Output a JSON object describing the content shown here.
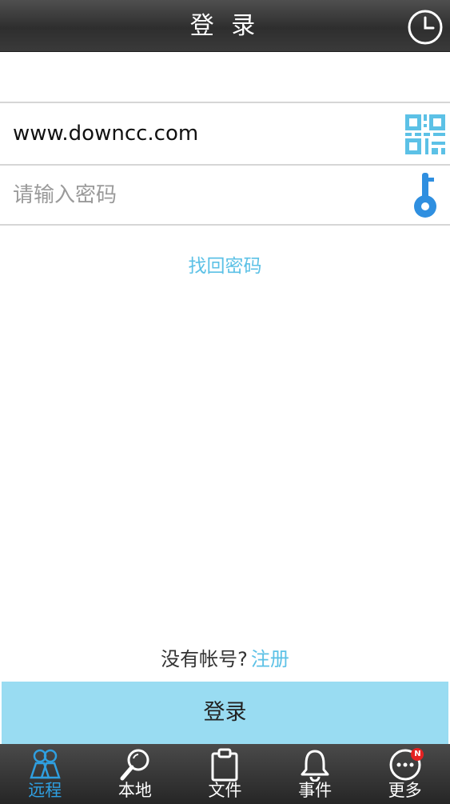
{
  "header": {
    "title": "登 录",
    "history_icon": "clock-icon"
  },
  "form": {
    "username_value": "www.downcc.com",
    "qr_icon": "qr-code-icon",
    "password_placeholder": "请输入密码",
    "key_icon": "key-icon"
  },
  "forgot_password_label": "找回密码",
  "register": {
    "question": "没有帐号?",
    "link": "注册"
  },
  "login_button_label": "登录",
  "colors": {
    "accent": "#5cc1e6",
    "login_button_bg": "#99dcf2",
    "active_tab": "#2f9fe0",
    "badge": "#e52222"
  },
  "tabs": [
    {
      "label": "远程",
      "icon": "remote-users-icon",
      "active": true
    },
    {
      "label": "本地",
      "icon": "magnifier-icon",
      "active": false
    },
    {
      "label": "文件",
      "icon": "clipboard-icon",
      "active": false
    },
    {
      "label": "事件",
      "icon": "bell-icon",
      "active": false
    },
    {
      "label": "更多",
      "icon": "more-icon",
      "active": false,
      "badge": "N"
    }
  ]
}
